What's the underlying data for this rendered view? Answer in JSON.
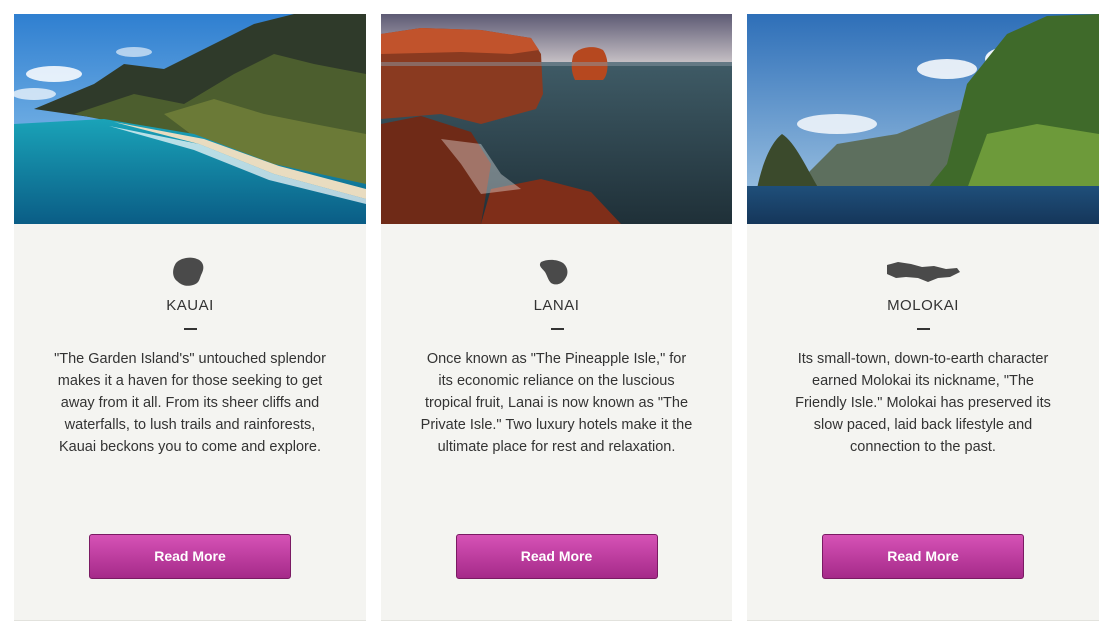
{
  "cards": [
    {
      "title": "KAUAI",
      "icon": "kauai-island-icon",
      "description": "\"The Garden Island's\" untouched splendor makes it a haven for those seeking to get away from it all. From its sheer cliffs and waterfalls, to lush trails and rainforests, Kauai beckons you to come and explore.",
      "button_label": "Read More"
    },
    {
      "title": "LANAI",
      "icon": "lanai-island-icon",
      "description": "Once known as \"The Pineapple Isle,\" for its economic reliance on the luscious tropical fruit, Lanai is now known as \"The Private Isle.\" Two luxury hotels make it the ultimate place for rest and relaxation.",
      "button_label": "Read More"
    },
    {
      "title": "MOLOKAI",
      "icon": "molokai-island-icon",
      "description": "Its small-town, down-to-earth character earned Molokai its nickname, \"The Friendly Isle.\" Molokai has preserved its slow paced, laid back lifestyle and connection to the past.",
      "button_label": "Read More"
    }
  ],
  "colors": {
    "card_background": "#f4f4f1",
    "button_top": "#d652b6",
    "button_bottom": "#a52a89",
    "text": "#333333",
    "icon": "#4a4a4a"
  }
}
